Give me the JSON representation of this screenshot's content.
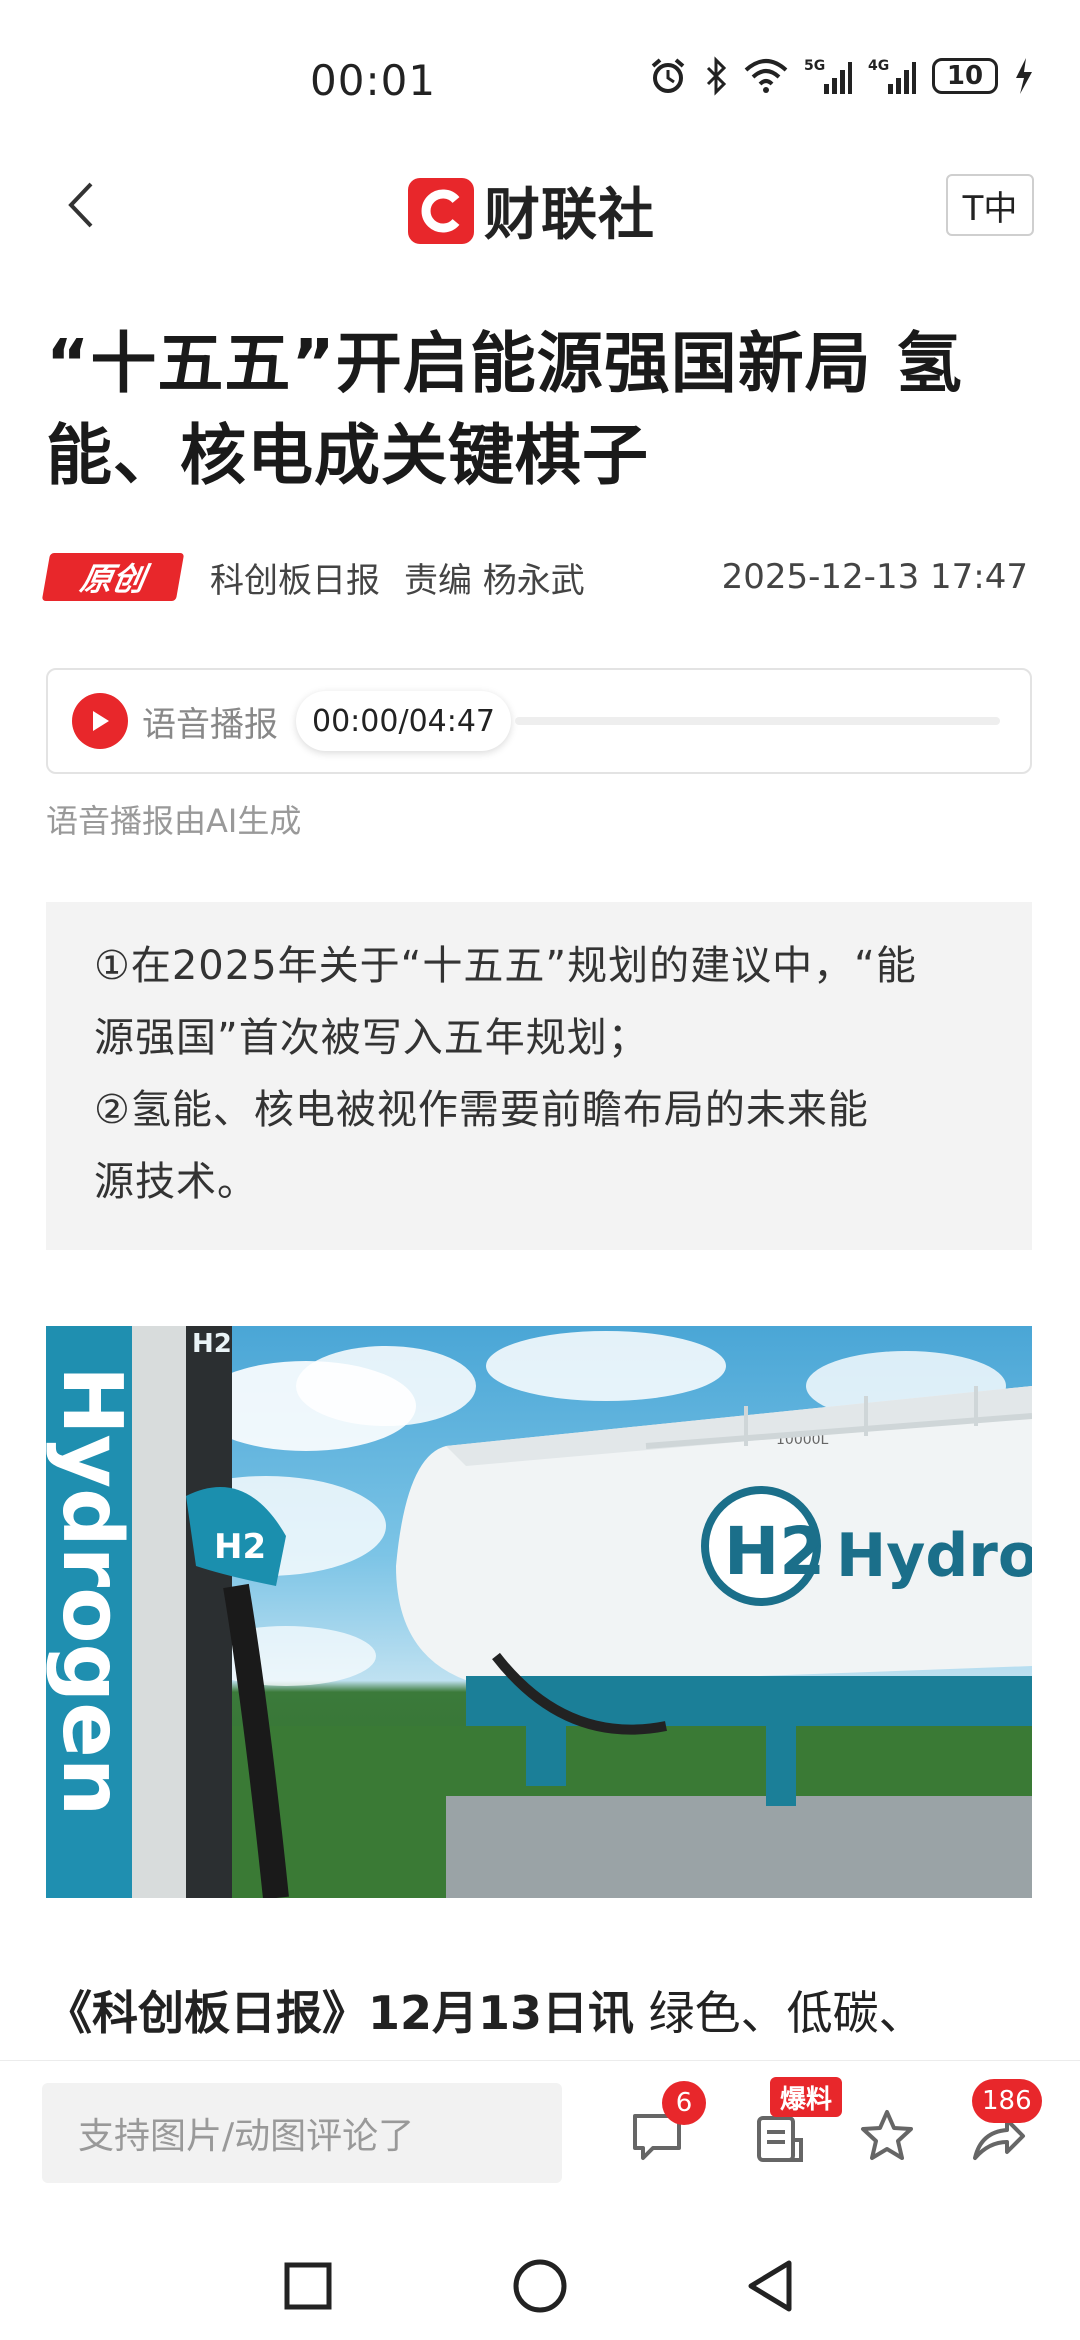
{
  "status_bar": {
    "time": "00:01",
    "battery": "10",
    "icons": [
      "alarm-icon",
      "bluetooth-icon",
      "wifi-icon",
      "signal-5g-icon",
      "signal-4g-icon",
      "battery-icon",
      "charging-icon"
    ],
    "network_5g": "5G",
    "network_4g": "4G"
  },
  "nav": {
    "logo_mark": "C",
    "logo_text": "财联社",
    "font_size_label": "T中"
  },
  "article": {
    "title": "“十五五”开启能源强国新局 氢能、核电成关键棋子",
    "badge": "原创",
    "source": "科创板日报",
    "editor": "责编 杨永武",
    "date": "2025-12-13 17:47",
    "audio_label": "语音播报",
    "audio_time": "00:00/04:47",
    "audio_progress": 0,
    "audio_note": "语音播报由AI生成",
    "summary": [
      "①在2025年关于“十五五”规划的建议中，“能",
      "源强国”首次被写入五年规划；",
      "②氢能、核电被视作需要前瞻布局的未来能",
      "源技术。"
    ],
    "image_texts": {
      "pump_vertical": "Hydrogen",
      "pump_top": "H2",
      "nozzle_label": "H2",
      "tank_brand": "Hydroge",
      "tank_h2": "H2",
      "tank_capacity": "10000L"
    },
    "lead_bold": "《科创板日报》12月13日讯",
    "lead_text": " 绿色、低碳、"
  },
  "action_bar": {
    "comment_placeholder": "支持图片/动图评论了",
    "comment_count": "6",
    "tip_label": "爆料",
    "share_count": "186"
  },
  "colors": {
    "brand_red": "#e8272b",
    "summary_bg": "#f3f3f3"
  }
}
